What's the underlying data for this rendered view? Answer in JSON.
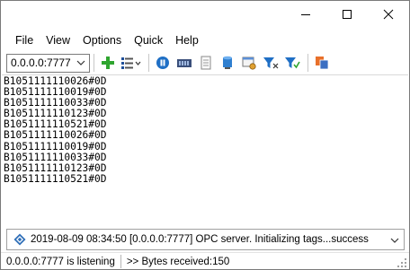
{
  "window": {
    "controls": {
      "minimize": "minimize-icon",
      "maximize": "maximize-icon",
      "close": "close-icon"
    }
  },
  "menu": {
    "items": [
      "File",
      "View",
      "Options",
      "Quick",
      "Help"
    ]
  },
  "toolbar": {
    "address_value": "0.0.0.0:7777",
    "icons": [
      "add-icon",
      "list-options-icon",
      "stop-icon",
      "connection-icon",
      "document-icon",
      "database-icon",
      "settings-window-icon",
      "filter-icon",
      "filter-clear-icon",
      "copy-icon"
    ]
  },
  "log": {
    "lines": [
      "B1051111110026#0D",
      "B1051111110019#0D",
      "B1051111110033#0D",
      "B1051111110123#0D",
      "B1051111110521#0D",
      "B1051111110026#0D",
      "B1051111110019#0D",
      "B1051111110033#0D",
      "B1051111110123#0D",
      "B1051111110521#0D"
    ]
  },
  "event": {
    "text": "2019-08-09 08:34:50 [0.0.0.0:7777] OPC server. Initializing tags...success"
  },
  "status": {
    "listening": "0.0.0.0:7777 is listening",
    "bytes": ">> Bytes received:150"
  },
  "colors": {
    "accent_blue": "#1f6fc5",
    "add_green": "#2fa52f"
  }
}
